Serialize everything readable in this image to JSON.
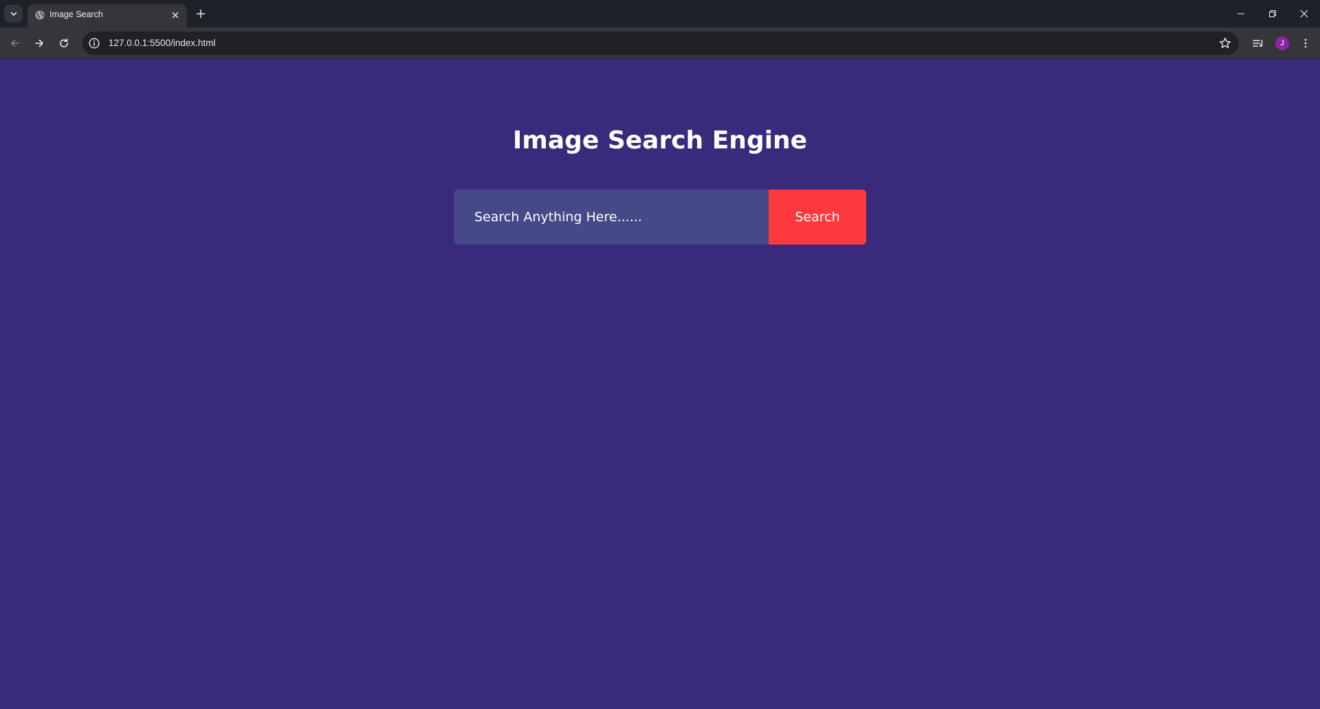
{
  "browser": {
    "tab_title": "Image Search",
    "url": "127.0.0.1:5500/index.html",
    "profile_initial": "J",
    "profile_color": "#8e24aa"
  },
  "page": {
    "title": "Image Search Engine",
    "background_color": "#392a7b"
  },
  "search": {
    "placeholder": "Search Anything Here......",
    "value": "",
    "input_color": "#454988",
    "button_label": "Search",
    "button_color": "#ff3a3f"
  }
}
